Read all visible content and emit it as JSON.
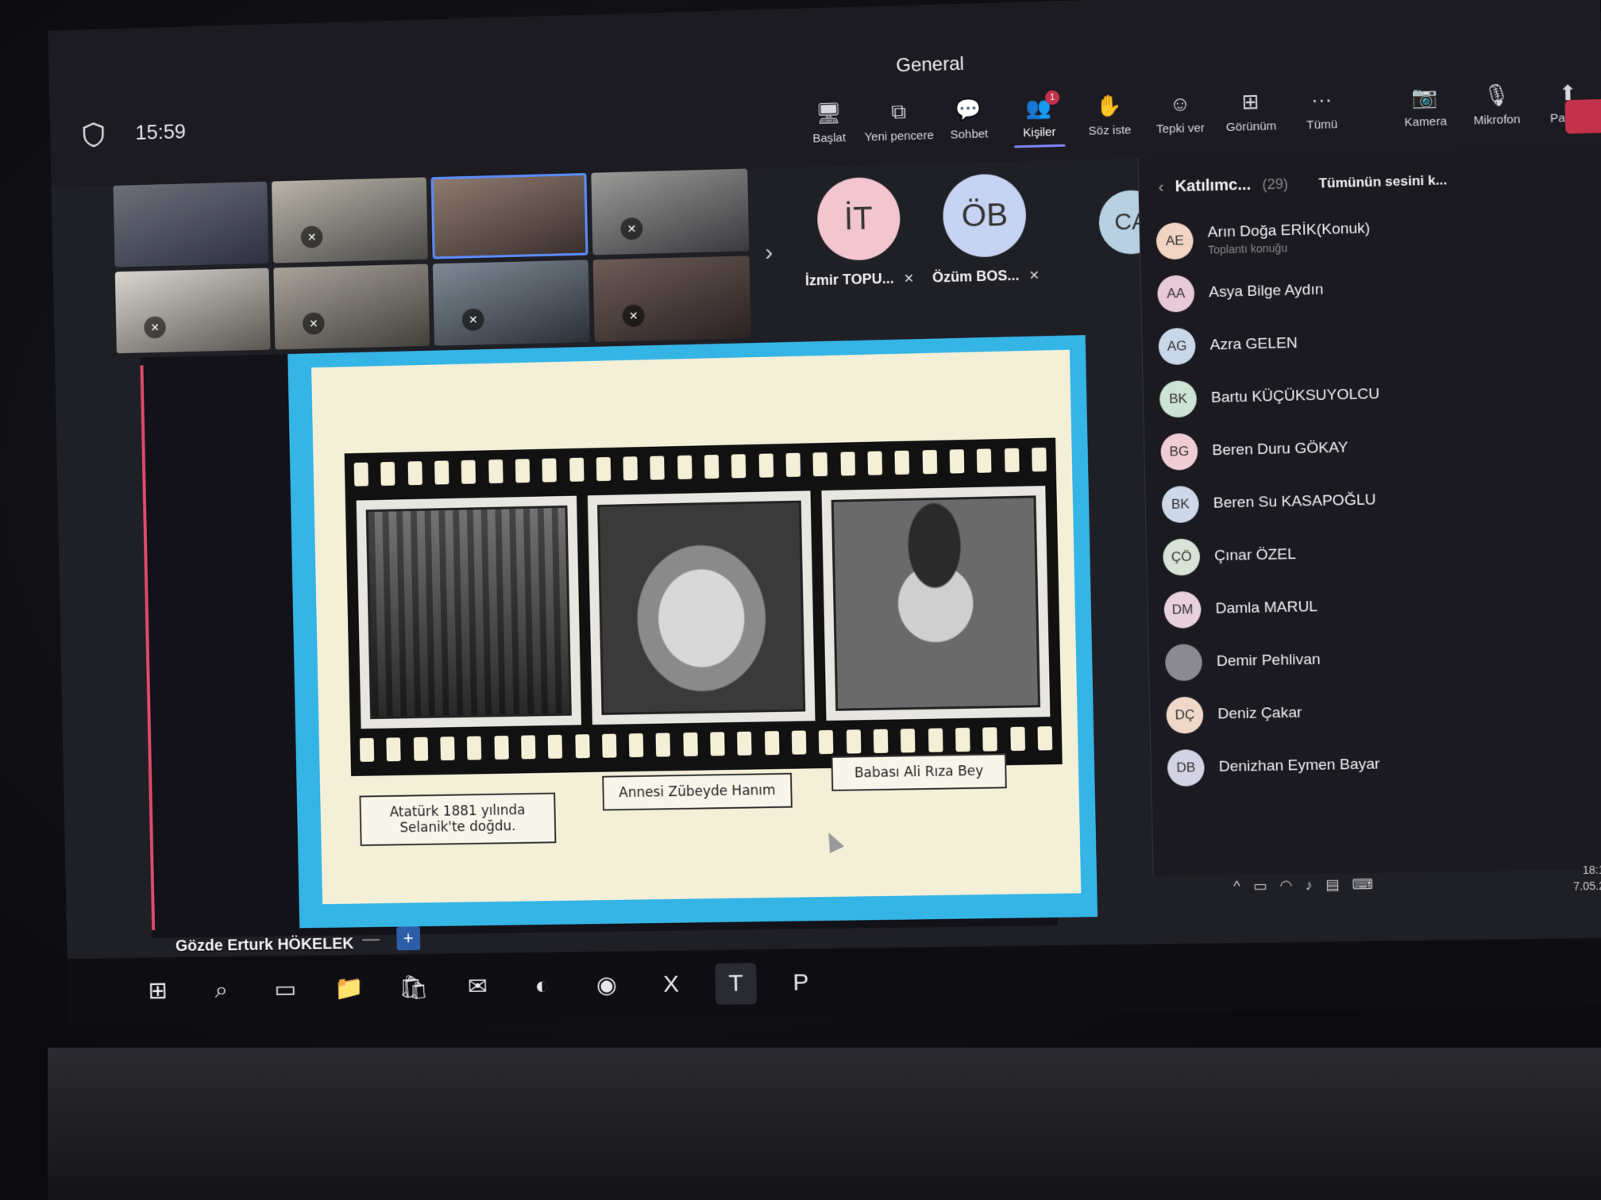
{
  "window": {
    "title": "General"
  },
  "header": {
    "clock": "15:59"
  },
  "toolbar": [
    {
      "key": "start",
      "label": "Başlat",
      "icon": "🖥"
    },
    {
      "key": "new-window",
      "label": "Yeni pencere",
      "icon": "⧉"
    },
    {
      "key": "chat",
      "label": "Sohbet",
      "icon": "💬"
    },
    {
      "key": "people",
      "label": "Kişiler",
      "icon": "👥",
      "badge": "1",
      "active": true
    },
    {
      "key": "raise-hand",
      "label": "Söz iste",
      "icon": "✋"
    },
    {
      "key": "react",
      "label": "Tepki ver",
      "icon": "☺"
    },
    {
      "key": "view",
      "label": "Görünüm",
      "icon": "⊞"
    },
    {
      "key": "more",
      "label": "Tümü",
      "icon": "···"
    },
    {
      "key": "camera",
      "label": "Kamera",
      "icon": "📷"
    },
    {
      "key": "mic",
      "label": "Mikrofon",
      "icon": "🎙"
    },
    {
      "key": "share",
      "label": "Paylaş",
      "icon": "⬆"
    }
  ],
  "avatars": [
    {
      "initials": "İT",
      "name": "İzmir TOPU...",
      "color": "#f3c6cf"
    },
    {
      "initials": "ÖB",
      "name": "Özüm BOS...",
      "color": "#c6d3f3"
    },
    {
      "initials": "CA",
      "name": "",
      "color": "#b7d1e3"
    }
  ],
  "slide": {
    "captions": [
      "Atatürk 1881 yılında Selanik'te doğdu.",
      "Annesi Zübeyde Hanım",
      "Babası Ali Rıza Bey"
    ]
  },
  "presenter": {
    "name": "Gözde Erturk HÖKELEK"
  },
  "people_panel": {
    "title": "Katılımc...",
    "count": "(29)",
    "mute_all": "Tümünün sesini k...",
    "participants": [
      {
        "initials": "AE",
        "name": "Arın Doğa ERİK(Konuk)",
        "sub": "Toplantı konuğu",
        "color": "#f1d4c3"
      },
      {
        "initials": "AA",
        "name": "Asya Bilge Aydın",
        "sub": "",
        "color": "#e8c9d8"
      },
      {
        "initials": "AG",
        "name": "Azra GELEN",
        "sub": "",
        "color": "#c9d8e8"
      },
      {
        "initials": "BK",
        "name": "Bartu KÜÇÜKSUYOLCU",
        "sub": "",
        "color": "#cde3d3"
      },
      {
        "initials": "BG",
        "name": "Beren Duru GÖKAY",
        "sub": "",
        "color": "#f0ccd4"
      },
      {
        "initials": "BK",
        "name": "Beren Su KASAPOĞLU",
        "sub": "",
        "color": "#cdd9e8"
      },
      {
        "initials": "ÇÖ",
        "name": "Çınar ÖZEL",
        "sub": "",
        "color": "#d6e3d6"
      },
      {
        "initials": "DM",
        "name": "Damla MARUL",
        "sub": "",
        "color": "#e8d0dc"
      },
      {
        "initials": "",
        "name": "Demir Pehlivan",
        "sub": "",
        "color": "#8a8a90"
      },
      {
        "initials": "DÇ",
        "name": "Deniz Çakar",
        "sub": "",
        "color": "#f0d8c8"
      },
      {
        "initials": "DB",
        "name": "Denizhan Eymen Bayar",
        "sub": "",
        "color": "#d3d3e3"
      }
    ]
  },
  "tray": {
    "time": "18:1",
    "date": "7.05.2"
  },
  "taskbar": [
    {
      "name": "start",
      "icon": "⊞"
    },
    {
      "name": "search",
      "icon": "⌕"
    },
    {
      "name": "task-view",
      "icon": "▭"
    },
    {
      "name": "file-explorer",
      "icon": "📁"
    },
    {
      "name": "store",
      "icon": "🛍"
    },
    {
      "name": "outlook",
      "icon": "✉"
    },
    {
      "name": "edge",
      "icon": "◐"
    },
    {
      "name": "chrome",
      "icon": "◉"
    },
    {
      "name": "excel",
      "icon": "X"
    },
    {
      "name": "teams",
      "icon": "T",
      "active": true
    },
    {
      "name": "powerpoint",
      "icon": "P"
    }
  ]
}
